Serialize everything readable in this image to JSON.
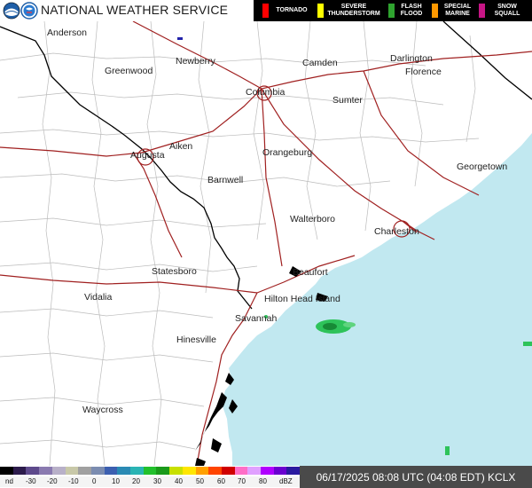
{
  "header": {
    "title": "NATIONAL WEATHER SERVICE",
    "logos": [
      "noaa-logo",
      "nws-logo"
    ]
  },
  "legend": [
    {
      "label": "TORNADO",
      "color": "#ff0000"
    },
    {
      "label": "SEVERE THUNDERSTORM",
      "color": "#ffff00"
    },
    {
      "label": "FLASH FLOOD",
      "color": "#2fa32f"
    },
    {
      "label": "SPECIAL MARINE",
      "color": "#ff9900"
    },
    {
      "label": "SNOW SQUALL",
      "color": "#c71585"
    }
  ],
  "map": {
    "ocean_color": "#c1e8f0",
    "land_color": "#ffffff",
    "state_border_color": "#000000",
    "county_line_color": "#bbbbbb",
    "highway_color": "#a02020",
    "cities": [
      "Anderson",
      "Greenwood",
      "Newberry",
      "Camden",
      "Darlington",
      "Florence",
      "Columbia",
      "Sumter",
      "Augusta",
      "Aiken",
      "Orangeburg",
      "Georgetown",
      "Barnwell",
      "Walterboro",
      "Charleston",
      "Statesboro",
      "Beaufort",
      "Vidalia",
      "Hilton Head Island",
      "Savannah",
      "Hinesville",
      "Waycross"
    ]
  },
  "scale": {
    "ticks": [
      "nd",
      "-30",
      "-20",
      "-10",
      "0",
      "10",
      "20",
      "30",
      "40",
      "50",
      "60",
      "70",
      "80",
      "dBZ"
    ]
  },
  "timestamp": "06/17/2025 08:08 UTC (04:08 EDT)  KCLX"
}
